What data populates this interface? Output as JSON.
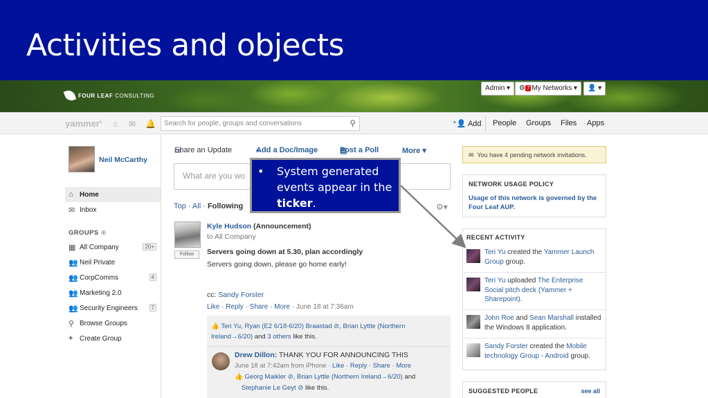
{
  "slide": {
    "title": "Activities and objects"
  },
  "banner": {
    "logo_bold": "FOUR LEAF",
    "logo_rest": "CONSULTING",
    "admin_label": "Admin ▾",
    "networks_badge": "7",
    "networks_label": "My Networks ▾",
    "user_menu": "▾"
  },
  "nav": {
    "brand": "yammer",
    "search_placeholder": "Search for people, groups and conversations",
    "add_label": "Add",
    "links": [
      "People",
      "Groups",
      "Files",
      "Apps"
    ]
  },
  "user": {
    "name": "Neil McCarthy"
  },
  "sidebar": {
    "home": "Home",
    "inbox": "Inbox",
    "groups_header": "GROUPS",
    "groups": [
      {
        "label": "All Company",
        "count": "20+"
      },
      {
        "label": "Neil Private",
        "count": ""
      },
      {
        "label": "CorpComms",
        "count": "4"
      },
      {
        "label": "Marketing 2.0",
        "count": ""
      },
      {
        "label": "Security Engineers",
        "count": "7"
      }
    ],
    "browse": "Browse Groups",
    "create": "Create Group"
  },
  "composer": {
    "tabs": [
      "Share an Update",
      "Add a Doc/Image",
      "Post a Poll",
      "More ▾"
    ],
    "placeholder": "What are you wo"
  },
  "feed": {
    "tab_top": "Top",
    "tab_all": "All",
    "tab_following": "Following",
    "follow_label": "Follow",
    "post": {
      "author": "Kyle Hudson",
      "tag": "(Announcement)",
      "to": "to All Company",
      "headline": "Servers going down at 5.30, plan accordingly",
      "body": "Servers going down, please go home early!",
      "cc_label": "cc:",
      "cc_name": "Sandy Forster",
      "actions": "Like · Reply · Share · More",
      "time": "· June 18 at 7:36am",
      "likes_line1_names": "Teri Yu, Ryan (E2 6/18-6/20) Braastad ⊘, Brian Lyttle (Northern",
      "likes_line2_names": "Ireland→6/20)",
      "likes_line2_rest": "and",
      "likes_others": "3 others",
      "likes_suffix": "like this."
    },
    "reply": {
      "author": "Drew Dillon:",
      "text": "THANK YOU FOR ANNOUNCING THIS",
      "meta": "June 18 at 7:42am from iPhone ·",
      "actions": "Like · Reply · Share · More",
      "likes_names": "Georg Maikler ⊘, Brian Lyttle (Northern Ireland→6/20)",
      "likes_and": "and",
      "likes_name2": "Stephanie Le Geyt ⊘",
      "likes_suffix": "like this."
    }
  },
  "right": {
    "invite": "You have 4 pending network invitations.",
    "policy_header": "NETWORK USAGE POLICY",
    "policy_text": "Usage of this network is governed by the Four Leaf AUP.",
    "recent_header": "RECENT ACTIVITY",
    "activities": [
      {
        "actor": "Teri Yu",
        "verb": " created the ",
        "object": "Yammer Launch Group",
        "suffix": " group."
      },
      {
        "actor": "Teri Yu",
        "verb": " uploaded ",
        "object": "The Enterprise Social pitch deck (Yammer + Sharepoint)",
        "suffix": "."
      },
      {
        "actor": "John Roe",
        "verb": " and ",
        "object": "Sean Marshall",
        "suffix": " installed the Windows 8 application."
      },
      {
        "actor": "Sandy Forster",
        "verb": " created the ",
        "object": "Mobile technology Group - Android",
        "suffix": " group."
      }
    ],
    "suggested_header": "SUGGESTED PEOPLE",
    "see_all": "see all"
  },
  "callout": {
    "bullet": "•",
    "text_before": "System generated events appear in the ",
    "text_bold": "ticker",
    "text_after": "."
  },
  "colors": {
    "slide_blue": "#00129a",
    "link_blue": "#2a5d99"
  }
}
